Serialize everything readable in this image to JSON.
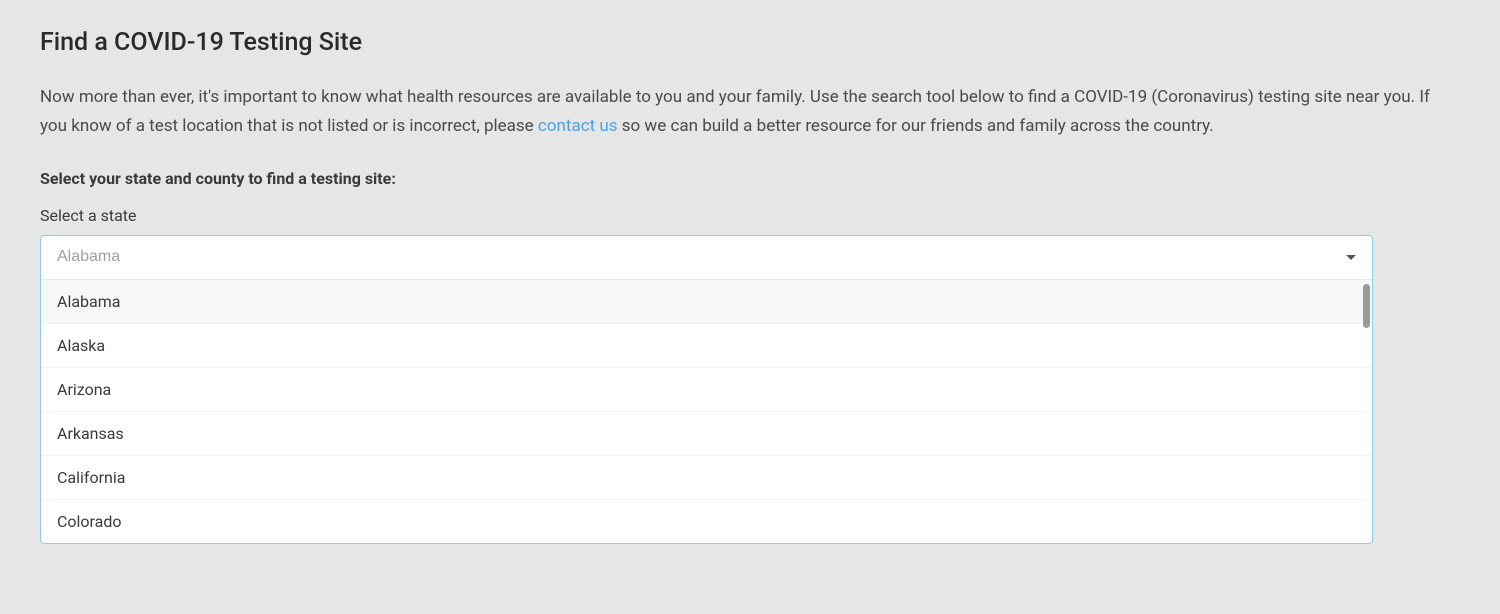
{
  "title": "Find a COVID-19 Testing Site",
  "intro": {
    "part1": "Now more than ever, it's important to know what health resources are available to you and your family. Use the search tool below to find a COVID-19 (Coronavirus) testing site near you. If you know of a test location that is not listed or is incorrect, please ",
    "link_text": "contact us",
    "part2": " so we can build a better resource for our friends and family across the country."
  },
  "prompt": "Select your state and county to find a testing site:",
  "state_field": {
    "label": "Select a state",
    "placeholder": "Alabama",
    "options": [
      "Alabama",
      "Alaska",
      "Arizona",
      "Arkansas",
      "California",
      "Colorado"
    ]
  }
}
